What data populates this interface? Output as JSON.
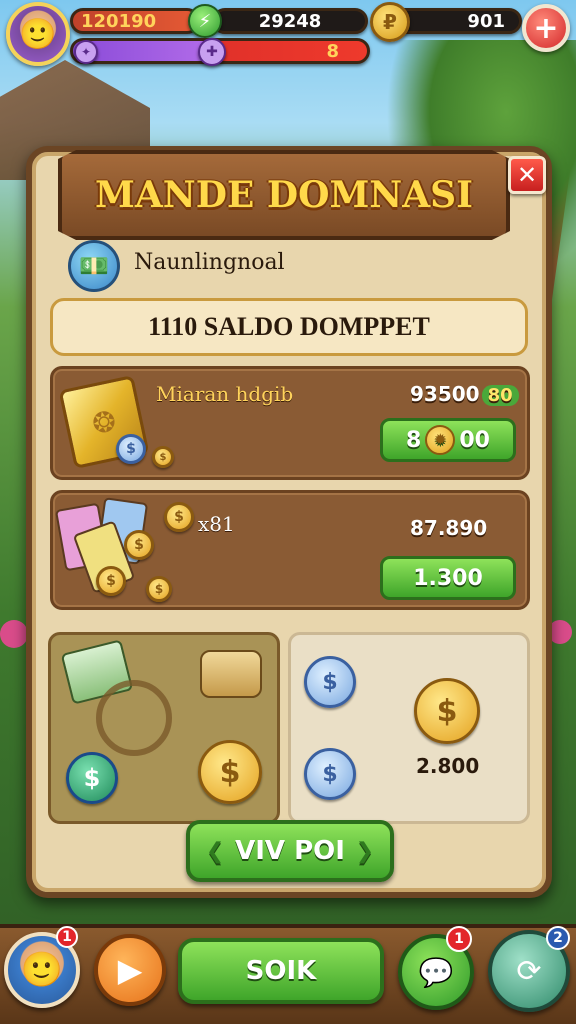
{
  "hud": {
    "score": "120190",
    "gems": "29248",
    "coins": "901",
    "xp_value": "8",
    "plus_label": "+",
    "gem_glyph": "⚡",
    "coin_glyph": "₽"
  },
  "panel": {
    "title": "MANDE DOMNASI",
    "close_label": "✕",
    "subtitle": "Naunlingnoal",
    "scroll_label": "1110 SALDO DOMPPET",
    "row1": {
      "label": "Miaran hdgib",
      "amount": "93500",
      "amount_tag": "80",
      "button_left": "8",
      "button_right": "00"
    },
    "row2": {
      "multiplier": "x81",
      "amount": "87.890",
      "button": "1.300"
    },
    "tile_right_amount": "2.800",
    "tab_button": "VIV POI"
  },
  "bottom": {
    "main_button": "SOIK",
    "badge_avatar": "1",
    "badge_chat": "1",
    "badge_settings": "2"
  },
  "colors": {
    "panel_bg": "#e8d6ad",
    "panel_border": "#6b4524",
    "banner_text": "#ffd94a",
    "green_button": "#3fa52a",
    "close_red": "#c71f1f"
  }
}
